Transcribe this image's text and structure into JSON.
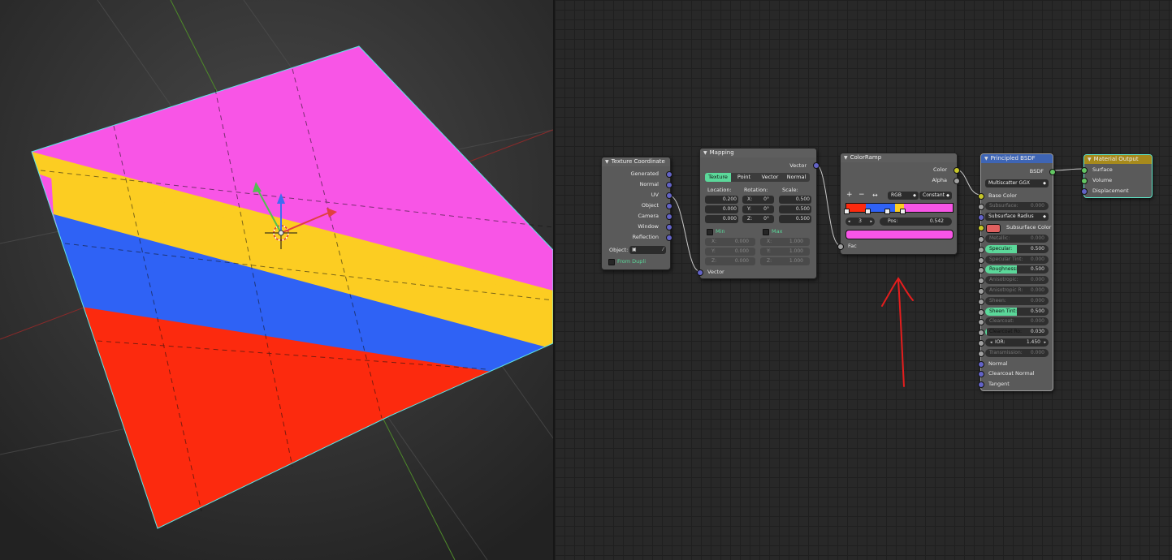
{
  "viewport": {
    "colors": {
      "magenta": "#f855e6",
      "yellow": "#fccd22",
      "blue": "#2f62f5",
      "red": "#fc2a0e"
    }
  },
  "nodes": {
    "texture_coordinate": {
      "title": "Texture Coordinate",
      "outputs": [
        "Generated",
        "Normal",
        "UV",
        "Object",
        "Camera",
        "Window",
        "Reflection"
      ],
      "object_label": "Object:",
      "from_dupli": "From Dupli"
    },
    "mapping": {
      "title": "Mapping",
      "output": "Vector",
      "input": "Vector",
      "tabs": [
        "Texture",
        "Point",
        "Vector",
        "Normal"
      ],
      "active_tab": 0,
      "location_label": "Location:",
      "rotation_label": "Rotation:",
      "scale_label": "Scale:",
      "location": [
        "0.200",
        "0.000",
        "0.000"
      ],
      "rotation": [
        {
          "axis": "X:",
          "v": "0°"
        },
        {
          "axis": "Y:",
          "v": "0°"
        },
        {
          "axis": "Z:",
          "v": "0°"
        }
      ],
      "scale": [
        "0.500",
        "0.500",
        "0.500"
      ],
      "min_label": "Min",
      "max_label": "Max",
      "min": [
        {
          "axis": "X:",
          "v": "0.000"
        },
        {
          "axis": "Y:",
          "v": "0.000"
        },
        {
          "axis": "Z:",
          "v": "0.000"
        }
      ],
      "max": [
        {
          "axis": "X:",
          "v": "1.000"
        },
        {
          "axis": "Y:",
          "v": "1.000"
        },
        {
          "axis": "Z:",
          "v": "1.000"
        }
      ]
    },
    "colorramp": {
      "title": "ColorRamp",
      "outputs": [
        "Color",
        "Alpha"
      ],
      "input": "Fac",
      "add": "+",
      "remove": "−",
      "flip": "↔",
      "color_mode": "RGB",
      "interpolation": "Constant",
      "active_index": "3",
      "pos_label": "Pos:",
      "pos_value": "0.542",
      "stop_colors": [
        "#fc2a0e",
        "#2f62f5",
        "#fccd22",
        "#f855e6"
      ],
      "active_color": "#f855e6"
    },
    "principled": {
      "title": "Principled BSDF",
      "output": "BSDF",
      "distribution": "Multiscatter GGX",
      "base_color": "Base Color",
      "subsurface": {
        "label": "Subsurface:",
        "value": "0.000",
        "fill": 0
      },
      "subsurface_radius": "Subsurface Radius",
      "subsurface_color": "Subsurface Color",
      "subsurface_color_swatch": "#e0605f",
      "sliders": [
        {
          "label": "Metallic:",
          "value": "0.000",
          "fill": 0
        },
        {
          "label": "Specular:",
          "value": "0.500",
          "fill": 0.5
        },
        {
          "label": "Specular Tint:",
          "value": "0.000",
          "fill": 0
        },
        {
          "label": "Roughness:",
          "value": "0.500",
          "fill": 0.5
        },
        {
          "label": "Anisotropic:",
          "value": "0.000",
          "fill": 0
        },
        {
          "label": "Anisotropic R:",
          "value": "0.000",
          "fill": 0
        },
        {
          "label": "Sheen:",
          "value": "0.000",
          "fill": 0
        },
        {
          "label": "Sheen Tint:",
          "value": "0.500",
          "fill": 0.5
        },
        {
          "label": "Clearcoat:",
          "value": "0.000",
          "fill": 0
        },
        {
          "label": "Clearcoat Ro:",
          "value": "0.030",
          "fill": 0.03
        }
      ],
      "ior": {
        "label": "IOR:",
        "value": "1.450"
      },
      "transmission": {
        "label": "Transmission:",
        "value": "0.000",
        "fill": 0
      },
      "vector_inputs": [
        "Normal",
        "Clearcoat Normal",
        "Tangent"
      ]
    },
    "material_output": {
      "title": "Material Output",
      "inputs": [
        "Surface",
        "Volume",
        "Displacement"
      ]
    }
  }
}
